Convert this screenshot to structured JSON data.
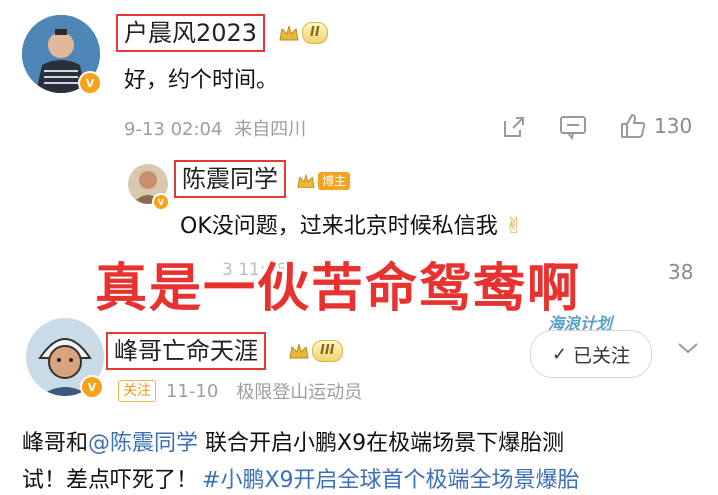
{
  "comment1": {
    "username": "户晨风2023",
    "level": "II",
    "text": "好，约个时间。",
    "timestamp": "9-13 02:04",
    "location": "来自四川",
    "like_count": "130"
  },
  "reply": {
    "username": "陈震同学",
    "badge": "博主",
    "text": "OK没问题，过来北京时候私信我",
    "emoji": "✌",
    "timestamp_partial": "3 11:18",
    "count_partial": "38"
  },
  "overlay_caption": "真是一伙苦命鸳鸯啊",
  "post": {
    "username": "峰哥亡命天涯",
    "level": "III",
    "follow_tag": "关注",
    "date": "11-10",
    "identity": "极限登山运动员",
    "follow_button": "已关注",
    "follow_check": "✓",
    "body_line1_prefix": "峰哥和",
    "mention": "@陈震同学",
    "body_line1_suffix": " 联合开启小鹏X9在极端场景下爆胎测",
    "body_line2_prefix": "试！差点吓死了！",
    "hashtag": "#小鹏X9开启全球首个极端全场景爆胎"
  },
  "background_watermark": "海浪计划",
  "icons": [
    "share-icon",
    "comment-icon",
    "like-icon",
    "crown-icon",
    "verified-icon",
    "chevron-down-icon"
  ],
  "colors": {
    "highlight_red": "#e53935",
    "caption_red": "#e8322f",
    "link_blue": "#3b6fb6",
    "badge_orange": "#f6a31a",
    "meta_gray": "#9e9e9e"
  }
}
